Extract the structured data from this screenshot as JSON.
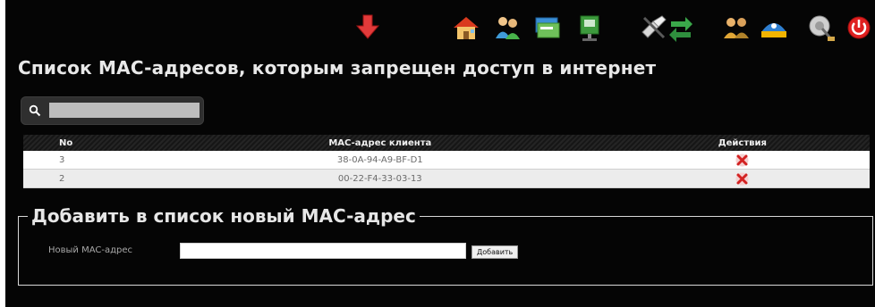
{
  "toolbar": {
    "icons": [
      "download-arrow-icon",
      "home-icon",
      "users-icon",
      "network-cards-icon",
      "network-adapter-icon",
      "tools-icon",
      "traffic-arrows-icon",
      "user-group-icon",
      "network-status-icon",
      "satellite-dish-icon",
      "power-icon"
    ]
  },
  "page": {
    "title": "Список MAC-адресов, которым запрещен доступ в интернет"
  },
  "search": {
    "value": ""
  },
  "table": {
    "columns": [
      "No",
      "MAC-адрес клиента",
      "Действия"
    ],
    "rows": [
      {
        "no": "3",
        "mac": "38-0A-94-A9-BF-D1"
      },
      {
        "no": "2",
        "mac": "00-22-F4-33-03-13"
      }
    ],
    "action_icon": "delete-icon"
  },
  "add_form": {
    "legend": "Добавить в список новый MAC-адрес",
    "label": "Новый MAC-адрес",
    "input_value": "",
    "button_label": "Добавить"
  },
  "colors": {
    "background": "#050505",
    "title_text": "#e8e8e8",
    "delete_red": "#d32222",
    "power_red": "#e02020"
  }
}
